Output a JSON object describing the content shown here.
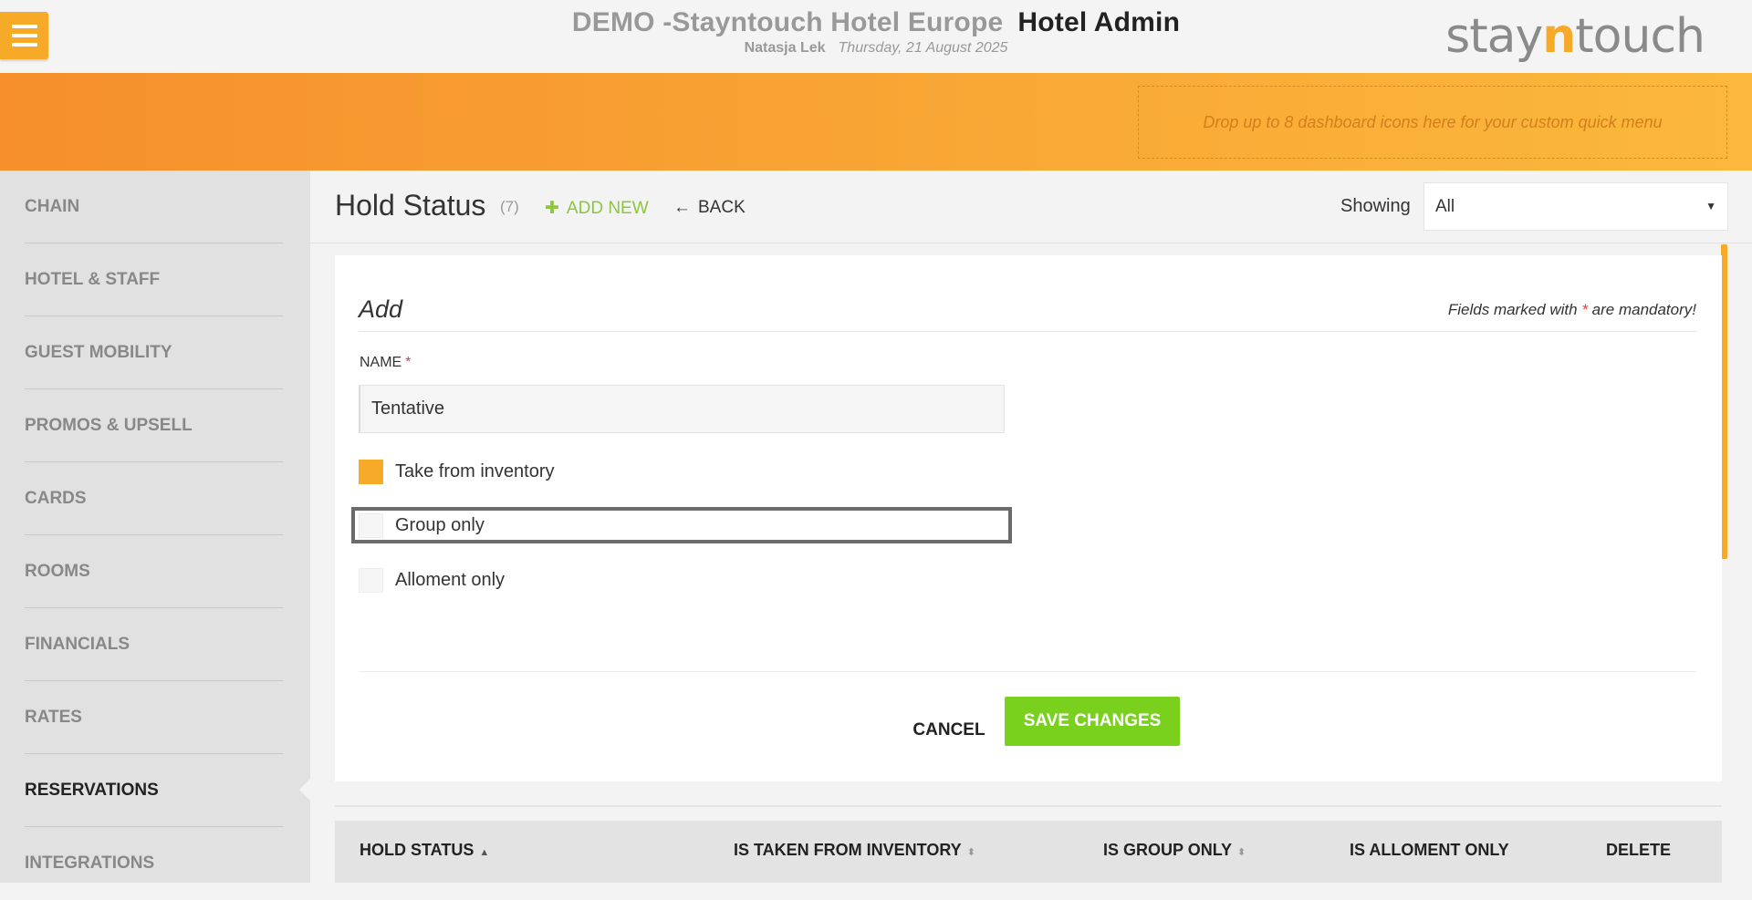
{
  "header": {
    "hotel_name": "DEMO -Stayntouch Hotel Europe",
    "app_name": "Hotel Admin",
    "user": "Natasja Lek",
    "date": "Thursday, 21 August 2025",
    "logo_prefix": "stay",
    "logo_n": "n",
    "logo_suffix": "touch",
    "menu_icon": "hamburger-icon"
  },
  "banner": {
    "dropzone_text": "Drop up to 8 dashboard icons here for your custom quick menu"
  },
  "sidebar": {
    "items": [
      {
        "label": "CHAIN"
      },
      {
        "label": "HOTEL & STAFF"
      },
      {
        "label": "GUEST MOBILITY"
      },
      {
        "label": "PROMOS & UPSELL"
      },
      {
        "label": "CARDS"
      },
      {
        "label": "ROOMS"
      },
      {
        "label": "FINANCIALS"
      },
      {
        "label": "RATES"
      },
      {
        "label": "RESERVATIONS",
        "active": true
      },
      {
        "label": "INTEGRATIONS"
      }
    ]
  },
  "page": {
    "title": "Hold Status",
    "count": "(7)",
    "add_new_icon": "plus-icon",
    "add_new_label": "ADD NEW",
    "back_icon": "arrow-left-icon",
    "back_label": "BACK",
    "showing_label": "Showing",
    "showing_value": "All"
  },
  "form": {
    "title": "Add",
    "mandatory_prefix": "Fields marked with ",
    "mandatory_star": "*",
    "mandatory_suffix": " are mandatory!",
    "name_label": "NAME",
    "name_star": "*",
    "name_value": "Tentative",
    "checkboxes": [
      {
        "label": "Take from inventory",
        "checked": true
      },
      {
        "label": "Group only",
        "checked": false
      },
      {
        "label": "Alloment only",
        "checked": false
      }
    ],
    "cancel_label": "CANCEL",
    "save_label": "SAVE CHANGES"
  },
  "table": {
    "columns": [
      {
        "label": "HOLD STATUS",
        "sort": "▲"
      },
      {
        "label": "IS TAKEN FROM INVENTORY",
        "sort": "⬍"
      },
      {
        "label": "IS GROUP ONLY",
        "sort": "⬍"
      },
      {
        "label": "IS ALLOMENT ONLY",
        "sort": ""
      },
      {
        "label": "DELETE",
        "sort": ""
      }
    ]
  },
  "colors": {
    "accent": "#f7a928",
    "save_button": "#79d11e",
    "add_new": "#8cc63f",
    "required_star": "#e23b3b"
  }
}
